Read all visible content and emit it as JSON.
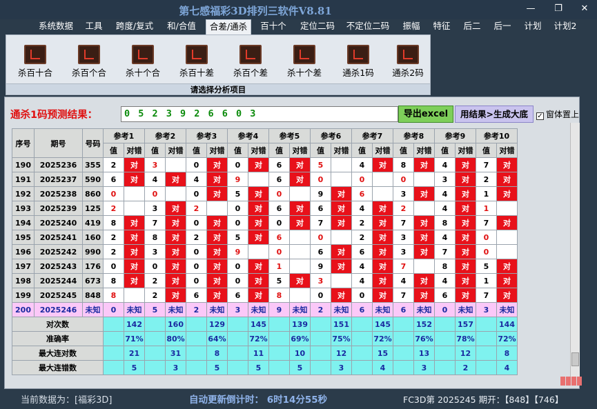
{
  "window": {
    "title": "第七感福彩3D排列三软件V8.81"
  },
  "menu": [
    "系统数据",
    "工具",
    "跨度/复式",
    "和/合值",
    "合差/通杀",
    "百十个",
    "定位二码",
    "不定位二码",
    "振幅",
    "特征",
    "后二",
    "后一",
    "计划",
    "计划2"
  ],
  "ribbon": {
    "buttons": [
      "杀百十合",
      "杀百个合",
      "杀十个合",
      "杀百十差",
      "杀百个差",
      "杀十个差",
      "通杀1码",
      "通杀2码"
    ],
    "caption": "请选择分析项目"
  },
  "prediction": {
    "label": "通杀1码预测结果：",
    "value": "0 5 2 3 9 2 6 6 0 3",
    "export_button": "导出excel",
    "generate_button": "用结果>生成大底",
    "stay_on_top": "窗体置上"
  },
  "table": {
    "head_seq": "序号",
    "head_issue": "期号",
    "head_code": "号码",
    "ref_headers": [
      "参考1",
      "参考2",
      "参考3",
      "参考4",
      "参考5",
      "参考6",
      "参考7",
      "参考8",
      "参考9",
      "参考10"
    ],
    "sub_val": "值",
    "sub_check": "对错",
    "rows": [
      {
        "seq": "190",
        "issue": "2025236",
        "code": "355",
        "refs": [
          [
            "2",
            ""
          ],
          [
            "3",
            ""
          ],
          [
            "0",
            ""
          ],
          [
            "0",
            ""
          ],
          [
            "6",
            ""
          ],
          [
            "5",
            ""
          ],
          [
            "4",
            ""
          ],
          [
            "8",
            ""
          ],
          [
            "4",
            ""
          ],
          [
            "7",
            ""
          ]
        ],
        "hit": [
          1,
          0,
          1,
          1,
          1,
          0,
          1,
          1,
          1,
          1
        ],
        "redval": [
          0,
          1,
          0,
          0,
          0,
          1,
          0,
          0,
          0,
          0
        ]
      },
      {
        "seq": "191",
        "issue": "2025237",
        "code": "590",
        "refs": [
          [
            "6",
            ""
          ],
          [
            "4",
            ""
          ],
          [
            "4",
            ""
          ],
          [
            "9",
            ""
          ],
          [
            "6",
            ""
          ],
          [
            "0",
            ""
          ],
          [
            "0",
            ""
          ],
          [
            "0",
            ""
          ],
          [
            "3",
            ""
          ],
          [
            "2",
            ""
          ]
        ],
        "hit": [
          1,
          1,
          1,
          0,
          1,
          0,
          0,
          0,
          1,
          1
        ],
        "redval": [
          0,
          0,
          0,
          1,
          0,
          1,
          1,
          1,
          0,
          0
        ]
      },
      {
        "seq": "192",
        "issue": "2025238",
        "code": "860",
        "refs": [
          [
            "0",
            ""
          ],
          [
            "0",
            ""
          ],
          [
            "0",
            ""
          ],
          [
            "5",
            ""
          ],
          [
            "0",
            ""
          ],
          [
            "9",
            ""
          ],
          [
            "6",
            ""
          ],
          [
            "3",
            ""
          ],
          [
            "4",
            ""
          ],
          [
            "1",
            ""
          ]
        ],
        "hit": [
          0,
          0,
          1,
          1,
          0,
          1,
          0,
          1,
          1,
          1
        ],
        "redval": [
          1,
          1,
          0,
          0,
          1,
          0,
          1,
          0,
          0,
          0
        ]
      },
      {
        "seq": "193",
        "issue": "2025239",
        "code": "125",
        "refs": [
          [
            "2",
            ""
          ],
          [
            "3",
            ""
          ],
          [
            "2",
            ""
          ],
          [
            "0",
            ""
          ],
          [
            "6",
            ""
          ],
          [
            "6",
            ""
          ],
          [
            "4",
            ""
          ],
          [
            "2",
            ""
          ],
          [
            "4",
            ""
          ],
          [
            "1",
            ""
          ]
        ],
        "hit": [
          0,
          1,
          0,
          1,
          1,
          1,
          1,
          0,
          1,
          0
        ],
        "redval": [
          1,
          0,
          1,
          0,
          0,
          0,
          0,
          1,
          0,
          1
        ]
      },
      {
        "seq": "194",
        "issue": "2025240",
        "code": "419",
        "refs": [
          [
            "8",
            ""
          ],
          [
            "7",
            ""
          ],
          [
            "0",
            ""
          ],
          [
            "0",
            ""
          ],
          [
            "0",
            ""
          ],
          [
            "7",
            ""
          ],
          [
            "2",
            ""
          ],
          [
            "7",
            ""
          ],
          [
            "8",
            ""
          ],
          [
            "7",
            ""
          ]
        ],
        "hit": [
          1,
          1,
          1,
          1,
          1,
          1,
          1,
          1,
          1,
          1
        ],
        "redval": [
          0,
          0,
          0,
          0,
          0,
          0,
          0,
          0,
          0,
          0
        ]
      },
      {
        "seq": "195",
        "issue": "2025241",
        "code": "160",
        "refs": [
          [
            "2",
            ""
          ],
          [
            "8",
            ""
          ],
          [
            "2",
            ""
          ],
          [
            "5",
            ""
          ],
          [
            "6",
            ""
          ],
          [
            "0",
            ""
          ],
          [
            "2",
            ""
          ],
          [
            "3",
            ""
          ],
          [
            "4",
            ""
          ],
          [
            "0",
            ""
          ]
        ],
        "hit": [
          1,
          1,
          1,
          1,
          0,
          0,
          1,
          1,
          1,
          0
        ],
        "redval": [
          0,
          0,
          0,
          0,
          1,
          1,
          0,
          0,
          0,
          1
        ]
      },
      {
        "seq": "196",
        "issue": "2025242",
        "code": "990",
        "refs": [
          [
            "2",
            ""
          ],
          [
            "3",
            ""
          ],
          [
            "0",
            ""
          ],
          [
            "9",
            ""
          ],
          [
            "0",
            ""
          ],
          [
            "6",
            ""
          ],
          [
            "6",
            ""
          ],
          [
            "3",
            ""
          ],
          [
            "7",
            ""
          ],
          [
            "0",
            ""
          ]
        ],
        "hit": [
          1,
          1,
          1,
          0,
          0,
          1,
          1,
          1,
          1,
          0
        ],
        "redval": [
          0,
          0,
          0,
          1,
          1,
          0,
          0,
          0,
          0,
          1
        ]
      },
      {
        "seq": "197",
        "issue": "2025243",
        "code": "176",
        "refs": [
          [
            "0",
            ""
          ],
          [
            "0",
            ""
          ],
          [
            "0",
            ""
          ],
          [
            "0",
            ""
          ],
          [
            "1",
            ""
          ],
          [
            "9",
            ""
          ],
          [
            "4",
            ""
          ],
          [
            "7",
            ""
          ],
          [
            "8",
            ""
          ],
          [
            "5",
            ""
          ]
        ],
        "hit": [
          1,
          1,
          1,
          1,
          0,
          1,
          1,
          0,
          1,
          1
        ],
        "redval": [
          0,
          0,
          0,
          0,
          1,
          0,
          0,
          1,
          0,
          0
        ]
      },
      {
        "seq": "198",
        "issue": "2025244",
        "code": "673",
        "refs": [
          [
            "8",
            ""
          ],
          [
            "2",
            ""
          ],
          [
            "0",
            ""
          ],
          [
            "0",
            ""
          ],
          [
            "5",
            ""
          ],
          [
            "3",
            ""
          ],
          [
            "4",
            ""
          ],
          [
            "4",
            ""
          ],
          [
            "4",
            ""
          ],
          [
            "1",
            ""
          ]
        ],
        "hit": [
          1,
          1,
          1,
          1,
          1,
          0,
          1,
          1,
          1,
          1
        ],
        "redval": [
          0,
          0,
          0,
          0,
          0,
          1,
          0,
          0,
          0,
          0
        ]
      },
      {
        "seq": "199",
        "issue": "2025245",
        "code": "848",
        "refs": [
          [
            "8",
            ""
          ],
          [
            "2",
            ""
          ],
          [
            "6",
            ""
          ],
          [
            "6",
            ""
          ],
          [
            "8",
            ""
          ],
          [
            "0",
            ""
          ],
          [
            "0",
            ""
          ],
          [
            "7",
            ""
          ],
          [
            "6",
            ""
          ],
          [
            "7",
            ""
          ]
        ],
        "hit": [
          0,
          1,
          1,
          1,
          0,
          1,
          1,
          1,
          1,
          1
        ],
        "redval": [
          1,
          0,
          0,
          0,
          1,
          0,
          0,
          0,
          0,
          0
        ]
      }
    ],
    "unknown_row": {
      "seq": "200",
      "issue": "2025246",
      "code": "未知",
      "vals": [
        "0",
        "5",
        "2",
        "3",
        "9",
        "2",
        "6",
        "6",
        "0",
        "3"
      ],
      "check": "未知"
    },
    "stats": [
      {
        "label": "对次数",
        "vals": [
          "142",
          "160",
          "129",
          "145",
          "139",
          "151",
          "145",
          "152",
          "157",
          "144"
        ]
      },
      {
        "label": "准确率",
        "vals": [
          "71%",
          "80%",
          "64%",
          "72%",
          "69%",
          "75%",
          "72%",
          "76%",
          "78%",
          "72%"
        ]
      },
      {
        "label": "最大连对数",
        "vals": [
          "21",
          "31",
          "8",
          "11",
          "10",
          "12",
          "15",
          "13",
          "12",
          "8"
        ]
      },
      {
        "label": "最大连错数",
        "vals": [
          "5",
          "3",
          "5",
          "5",
          "5",
          "3",
          "4",
          "3",
          "2",
          "4"
        ]
      }
    ],
    "hit_text": "对"
  },
  "status": {
    "data_source": "当前数据为：[福彩3D]",
    "countdown": "自动更新倒计时：  6时14分55秒",
    "issue_info": "FC3D第 2025245 期开：【848】【746】"
  }
}
